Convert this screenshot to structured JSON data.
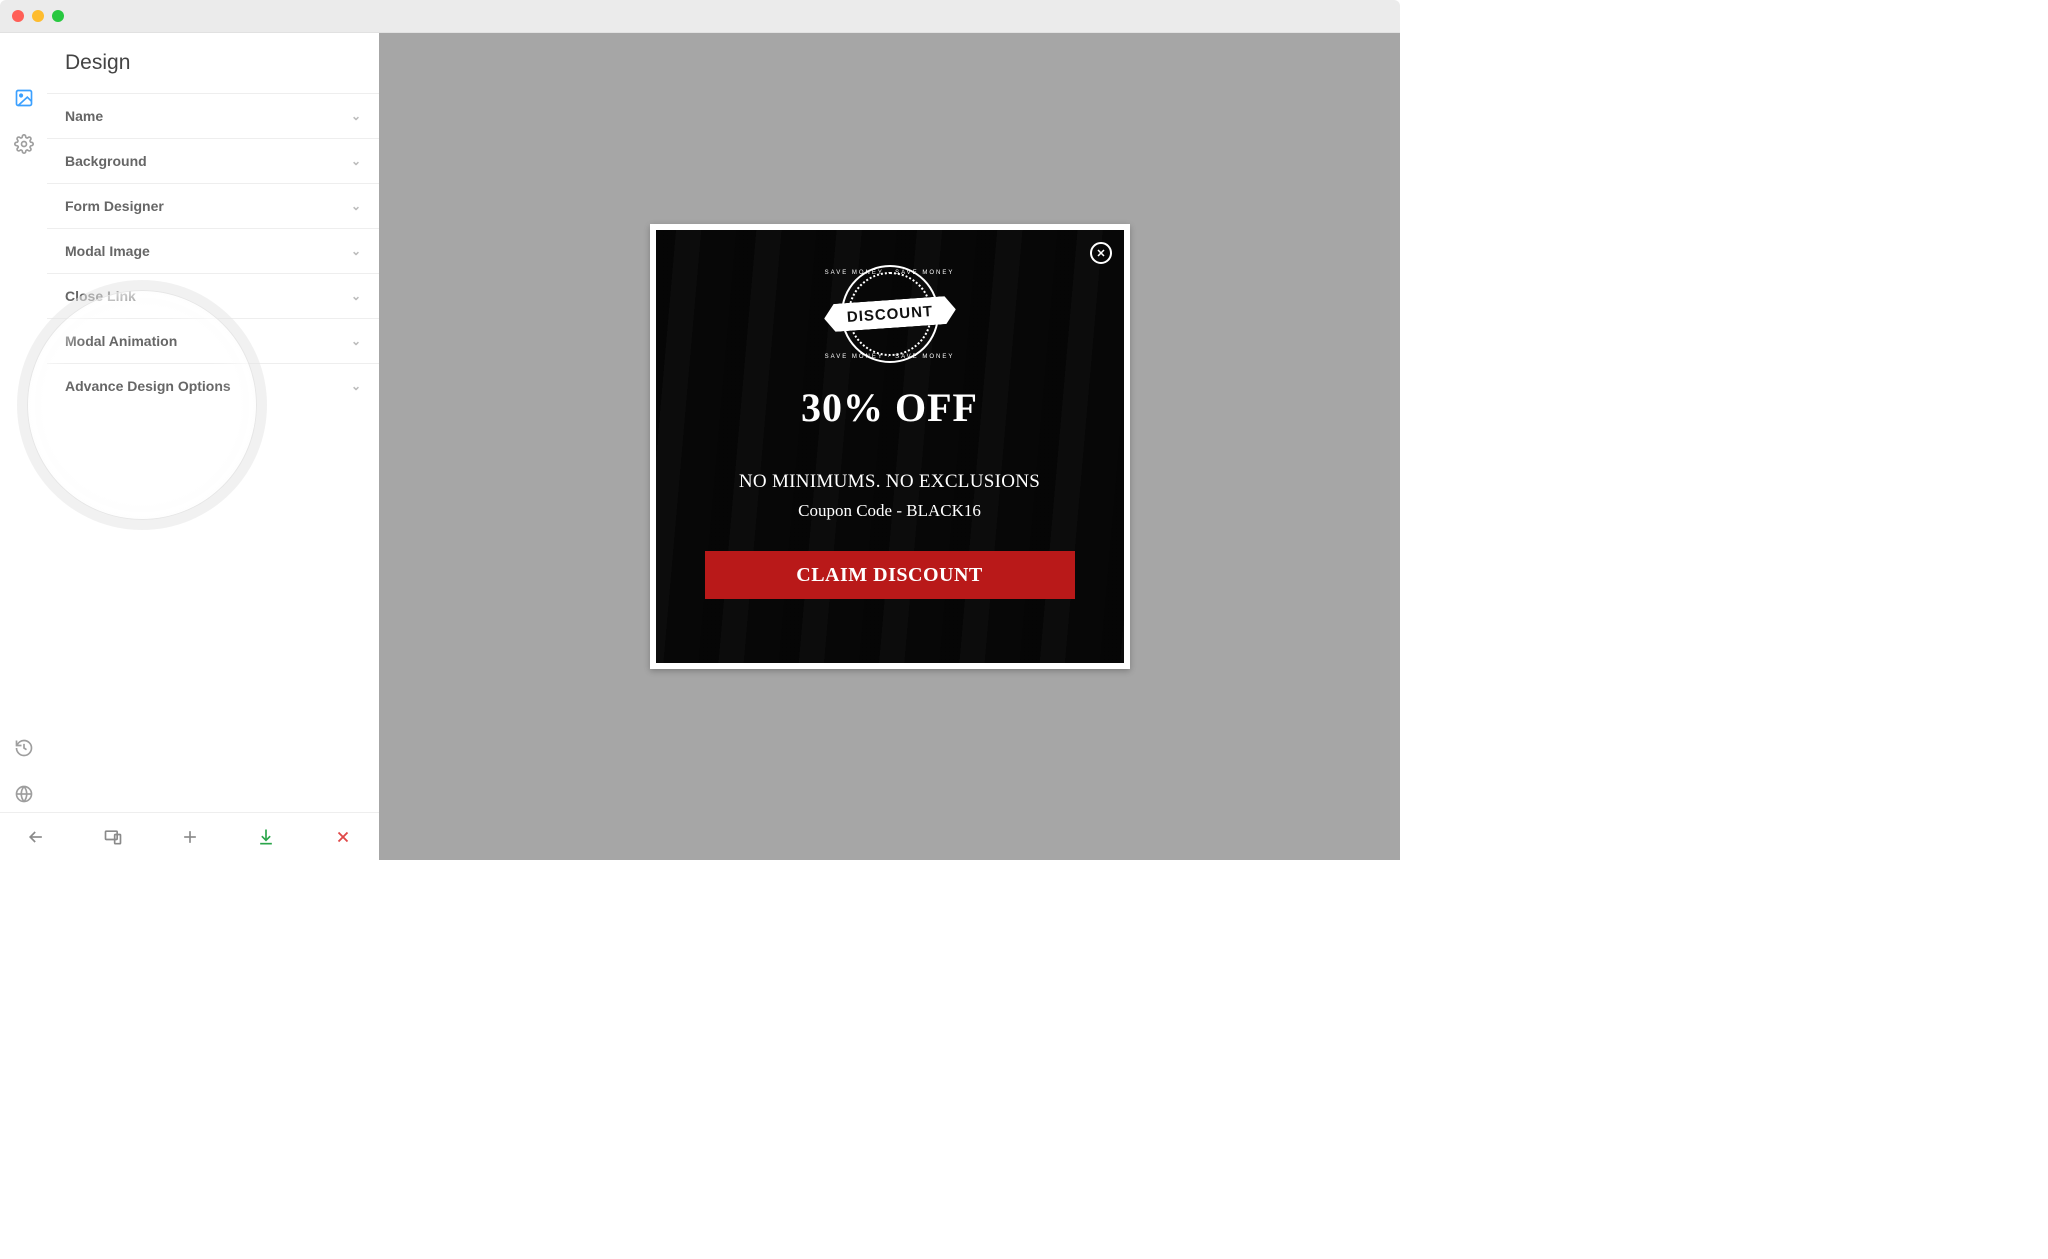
{
  "sidebar": {
    "title": "Design",
    "items": [
      {
        "label": "Name"
      },
      {
        "label": "Background"
      },
      {
        "label": "Form Designer"
      },
      {
        "label": "Modal Image"
      },
      {
        "label": "Close Link"
      },
      {
        "label": "Modal Animation"
      },
      {
        "label": "Advance Design Options"
      }
    ]
  },
  "modal": {
    "badge_text": "DISCOUNT",
    "badge_arc": "SAVE MONEY · SAVE MONEY",
    "headline": "30% OFF",
    "sub1": "NO MINIMUMS. NO EXCLUSIONS",
    "sub2": "Coupon Code - BLACK16",
    "cta": "CLAIM DISCOUNT"
  },
  "colors": {
    "cta_bg": "#b91919",
    "canvas_bg": "#a6a6a6",
    "accent": "#3ba0ff"
  }
}
